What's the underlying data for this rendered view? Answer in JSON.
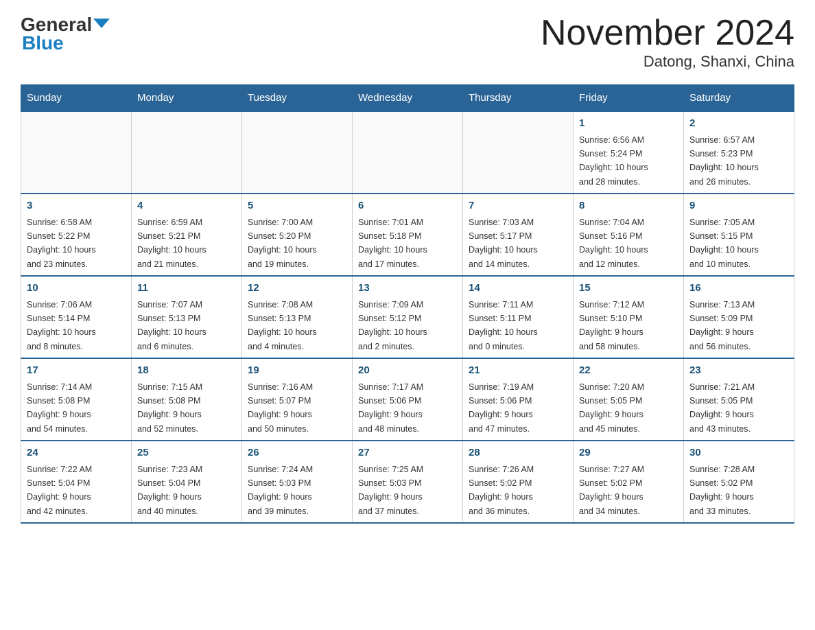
{
  "header": {
    "logo_general": "General",
    "logo_blue": "Blue",
    "month_title": "November 2024",
    "location": "Datong, Shanxi, China"
  },
  "days_of_week": [
    "Sunday",
    "Monday",
    "Tuesday",
    "Wednesday",
    "Thursday",
    "Friday",
    "Saturday"
  ],
  "weeks": [
    [
      {
        "day": "",
        "info": ""
      },
      {
        "day": "",
        "info": ""
      },
      {
        "day": "",
        "info": ""
      },
      {
        "day": "",
        "info": ""
      },
      {
        "day": "",
        "info": ""
      },
      {
        "day": "1",
        "info": "Sunrise: 6:56 AM\nSunset: 5:24 PM\nDaylight: 10 hours\nand 28 minutes."
      },
      {
        "day": "2",
        "info": "Sunrise: 6:57 AM\nSunset: 5:23 PM\nDaylight: 10 hours\nand 26 minutes."
      }
    ],
    [
      {
        "day": "3",
        "info": "Sunrise: 6:58 AM\nSunset: 5:22 PM\nDaylight: 10 hours\nand 23 minutes."
      },
      {
        "day": "4",
        "info": "Sunrise: 6:59 AM\nSunset: 5:21 PM\nDaylight: 10 hours\nand 21 minutes."
      },
      {
        "day": "5",
        "info": "Sunrise: 7:00 AM\nSunset: 5:20 PM\nDaylight: 10 hours\nand 19 minutes."
      },
      {
        "day": "6",
        "info": "Sunrise: 7:01 AM\nSunset: 5:18 PM\nDaylight: 10 hours\nand 17 minutes."
      },
      {
        "day": "7",
        "info": "Sunrise: 7:03 AM\nSunset: 5:17 PM\nDaylight: 10 hours\nand 14 minutes."
      },
      {
        "day": "8",
        "info": "Sunrise: 7:04 AM\nSunset: 5:16 PM\nDaylight: 10 hours\nand 12 minutes."
      },
      {
        "day": "9",
        "info": "Sunrise: 7:05 AM\nSunset: 5:15 PM\nDaylight: 10 hours\nand 10 minutes."
      }
    ],
    [
      {
        "day": "10",
        "info": "Sunrise: 7:06 AM\nSunset: 5:14 PM\nDaylight: 10 hours\nand 8 minutes."
      },
      {
        "day": "11",
        "info": "Sunrise: 7:07 AM\nSunset: 5:13 PM\nDaylight: 10 hours\nand 6 minutes."
      },
      {
        "day": "12",
        "info": "Sunrise: 7:08 AM\nSunset: 5:13 PM\nDaylight: 10 hours\nand 4 minutes."
      },
      {
        "day": "13",
        "info": "Sunrise: 7:09 AM\nSunset: 5:12 PM\nDaylight: 10 hours\nand 2 minutes."
      },
      {
        "day": "14",
        "info": "Sunrise: 7:11 AM\nSunset: 5:11 PM\nDaylight: 10 hours\nand 0 minutes."
      },
      {
        "day": "15",
        "info": "Sunrise: 7:12 AM\nSunset: 5:10 PM\nDaylight: 9 hours\nand 58 minutes."
      },
      {
        "day": "16",
        "info": "Sunrise: 7:13 AM\nSunset: 5:09 PM\nDaylight: 9 hours\nand 56 minutes."
      }
    ],
    [
      {
        "day": "17",
        "info": "Sunrise: 7:14 AM\nSunset: 5:08 PM\nDaylight: 9 hours\nand 54 minutes."
      },
      {
        "day": "18",
        "info": "Sunrise: 7:15 AM\nSunset: 5:08 PM\nDaylight: 9 hours\nand 52 minutes."
      },
      {
        "day": "19",
        "info": "Sunrise: 7:16 AM\nSunset: 5:07 PM\nDaylight: 9 hours\nand 50 minutes."
      },
      {
        "day": "20",
        "info": "Sunrise: 7:17 AM\nSunset: 5:06 PM\nDaylight: 9 hours\nand 48 minutes."
      },
      {
        "day": "21",
        "info": "Sunrise: 7:19 AM\nSunset: 5:06 PM\nDaylight: 9 hours\nand 47 minutes."
      },
      {
        "day": "22",
        "info": "Sunrise: 7:20 AM\nSunset: 5:05 PM\nDaylight: 9 hours\nand 45 minutes."
      },
      {
        "day": "23",
        "info": "Sunrise: 7:21 AM\nSunset: 5:05 PM\nDaylight: 9 hours\nand 43 minutes."
      }
    ],
    [
      {
        "day": "24",
        "info": "Sunrise: 7:22 AM\nSunset: 5:04 PM\nDaylight: 9 hours\nand 42 minutes."
      },
      {
        "day": "25",
        "info": "Sunrise: 7:23 AM\nSunset: 5:04 PM\nDaylight: 9 hours\nand 40 minutes."
      },
      {
        "day": "26",
        "info": "Sunrise: 7:24 AM\nSunset: 5:03 PM\nDaylight: 9 hours\nand 39 minutes."
      },
      {
        "day": "27",
        "info": "Sunrise: 7:25 AM\nSunset: 5:03 PM\nDaylight: 9 hours\nand 37 minutes."
      },
      {
        "day": "28",
        "info": "Sunrise: 7:26 AM\nSunset: 5:02 PM\nDaylight: 9 hours\nand 36 minutes."
      },
      {
        "day": "29",
        "info": "Sunrise: 7:27 AM\nSunset: 5:02 PM\nDaylight: 9 hours\nand 34 minutes."
      },
      {
        "day": "30",
        "info": "Sunrise: 7:28 AM\nSunset: 5:02 PM\nDaylight: 9 hours\nand 33 minutes."
      }
    ]
  ]
}
